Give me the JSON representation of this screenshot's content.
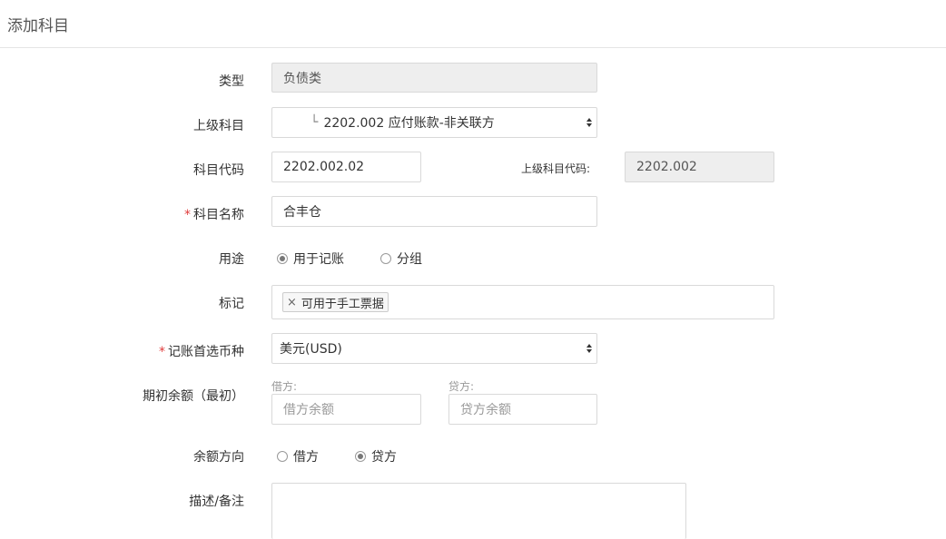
{
  "header": {
    "title": "添加科目"
  },
  "form": {
    "type": {
      "label": "类型",
      "value": "负债类"
    },
    "parent": {
      "label": "上级科目",
      "tree_prefix": "└",
      "value": "2202.002 应付账款-非关联方"
    },
    "code": {
      "label": "科目代码",
      "value": "2202.002.02"
    },
    "parent_code": {
      "label": "上级科目代码:",
      "value": "2202.002"
    },
    "name": {
      "required_mark": "*",
      "label": "科目名称",
      "value": "合丰仓"
    },
    "usage": {
      "label": "用途",
      "options": [
        {
          "label": "用于记账",
          "checked": true
        },
        {
          "label": "分组",
          "checked": false
        }
      ]
    },
    "tags": {
      "label": "标记",
      "items": [
        {
          "remove": "×",
          "label": "可用于手工票据"
        }
      ]
    },
    "currency": {
      "required_mark": "*",
      "label": "记账首选币种",
      "value": "美元(USD)"
    },
    "opening_balance": {
      "label": "期初余额（最初）",
      "debit": {
        "label": "借方:",
        "placeholder": "借方余额"
      },
      "credit": {
        "label": "贷方:",
        "placeholder": "贷方余额"
      }
    },
    "balance_direction": {
      "label": "余额方向",
      "options": [
        {
          "label": "借方",
          "checked": false
        },
        {
          "label": "贷方",
          "checked": true
        }
      ]
    },
    "description": {
      "label": "描述/备注",
      "value": ""
    }
  }
}
